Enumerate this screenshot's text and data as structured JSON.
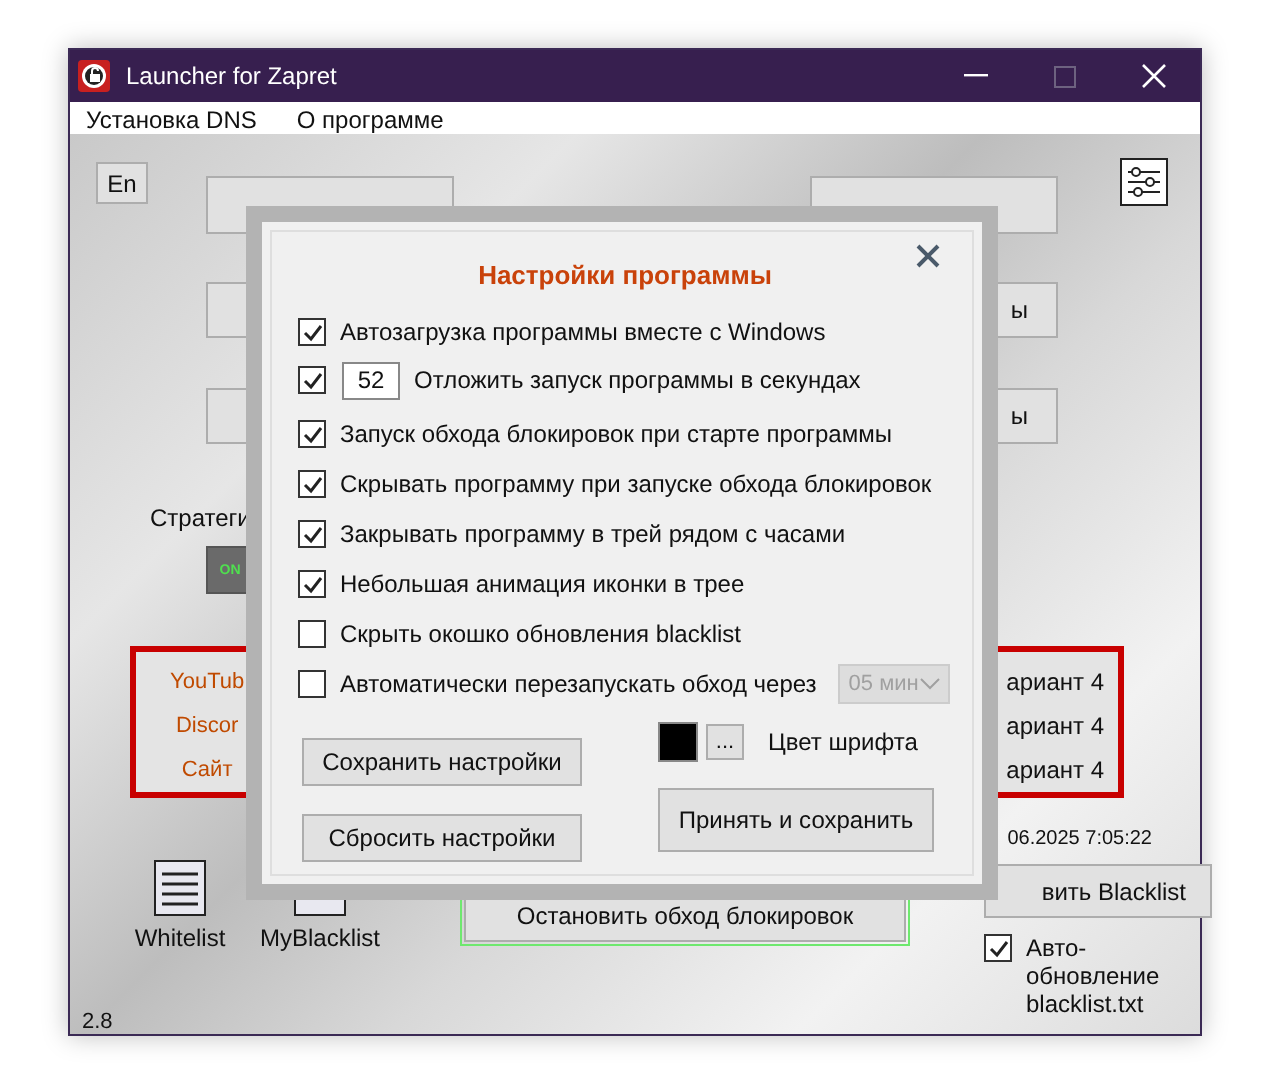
{
  "window": {
    "title": "Launcher for Zapret",
    "maximize_disabled": true
  },
  "menu": [
    "Установка DNS",
    "О программе"
  ],
  "main": {
    "lang_button": "En",
    "mid_buttons": [
      {
        "right": "ы"
      },
      {
        "right": "ы"
      }
    ],
    "strategy_label": "Стратеги",
    "toggle": {
      "label": "ON",
      "on": true
    },
    "services": [
      {
        "name": "YouTub",
        "variant": "ариант 4"
      },
      {
        "name": "Discor",
        "variant": "ариант 4"
      },
      {
        "name": "Сайт",
        "variant": "ариант 4"
      }
    ],
    "update_time": "06.2025 7:05:22",
    "lists": [
      {
        "label": "Whitelist"
      },
      {
        "label": "MyBlacklist"
      }
    ],
    "stop_button": "Остановить обход блокировок",
    "blacklist_button": "вить Blacklist",
    "auto_update": {
      "label": "Авто-обновление blacklist.txt",
      "checked": true
    },
    "version": "2.8"
  },
  "dialog": {
    "title": "Настройки программы",
    "options": [
      {
        "kind": "checkbox",
        "label": "Автозагрузка программы вместе с Windows",
        "checked": true
      },
      {
        "kind": "number",
        "label": "Отложить запуск программы в секундах",
        "checked": true,
        "value": "52"
      },
      {
        "kind": "checkbox",
        "label": "Запуск обхода блокировок при старте программы",
        "checked": true
      },
      {
        "kind": "checkbox",
        "label": "Скрывать программу при запуске обхода блокировок",
        "checked": true
      },
      {
        "kind": "checkbox",
        "label": "Закрывать программу в трей рядом с часами",
        "checked": true
      },
      {
        "kind": "checkbox",
        "label": "Небольшая анимация иконки в трее",
        "checked": true
      },
      {
        "kind": "checkbox",
        "label": "Скрыть окошко обновления blacklist",
        "checked": false
      },
      {
        "kind": "dropdown",
        "label": "Автоматически перезапускать обход через",
        "checked": false,
        "value": "05 мин",
        "disabled": true
      }
    ],
    "save_button": "Сохранить настройки",
    "reset_button": "Сбросить настройки",
    "font_color": {
      "color": "#000000",
      "button": "...",
      "label": "Цвет шрифта"
    },
    "apply_button": "Принять и сохранить"
  }
}
